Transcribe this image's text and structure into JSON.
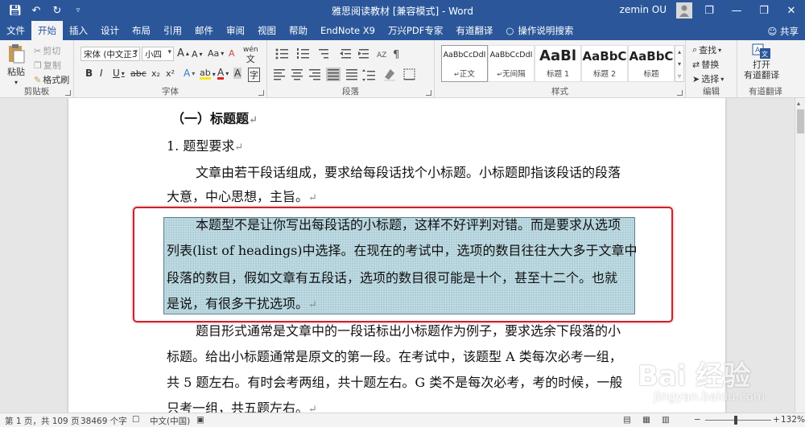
{
  "window": {
    "title": "雅思阅读教材 [兼容模式] - Word",
    "user": "zemin OU"
  },
  "tabs": [
    "文件",
    "开始",
    "插入",
    "设计",
    "布局",
    "引用",
    "邮件",
    "审阅",
    "视图",
    "帮助",
    "EndNote X9",
    "万兴PDF专家",
    "有道翻译"
  ],
  "active_tab": "开始",
  "tell_me": "操作说明搜索",
  "share": "共享",
  "ribbon": {
    "clipboard": {
      "label": "剪贴板",
      "paste": "粘贴",
      "cut": "剪切",
      "copy": "复制",
      "format_painter": "格式刷"
    },
    "font": {
      "label": "字体",
      "font_name": "宋体 (中文正3",
      "font_size": "小四",
      "grow": "A",
      "shrink": "A",
      "aa": "Aa",
      "clear": "A",
      "wen": "wén",
      "bold": "B",
      "italic": "I",
      "underline": "U",
      "strike": "abc",
      "sub": "x₂",
      "sup": "x²",
      "effects": "A",
      "highlight": "ab",
      "color": "A",
      "shading": "A",
      "border": "字"
    },
    "paragraph": {
      "label": "段落"
    },
    "styles": {
      "label": "样式",
      "items": [
        {
          "sample": "AaBbCcDdI",
          "name": "正文"
        },
        {
          "sample": "AaBbCcDdI",
          "name": "无间隔"
        },
        {
          "sample": "AaBl",
          "name": "标题 1"
        },
        {
          "sample": "AaBbC",
          "name": "标题 2"
        },
        {
          "sample": "AaBbC",
          "name": "标题"
        }
      ]
    },
    "editing": {
      "label": "编辑",
      "find": "查找",
      "replace": "替换",
      "select": "选择"
    },
    "translate": {
      "label": "有道翻译",
      "open": "打开",
      "open2": "有道翻译"
    }
  },
  "document": {
    "lines": [
      "（一）标题题",
      "1.  题型要求",
      "文章由若干段话组成，要求给每段话找个小标题。小标题即指该段话的段落",
      "大意，中心思想，主旨。",
      "本题型不是让你写出每段话的小标题，这样不好评判对错。而是要求从选项",
      "列表(list of headings)中选择。在现在的考试中，选项的数目往往大大多于文章中",
      "段落的数目，假如文章有五段话，选项的数目很可能是十个，甚至十二个。也就",
      "是说，有很多干扰选项。",
      "题目形式通常是文章中的一段话标出小标题作为例子，要求选余下段落的小",
      "标题。给出小标题通常是原文的第一段。在考试中，该题型 A 类每次必考一组，",
      "共 5 题左右。有时会考两组，共十题左右。G 类不是每次必考，考的时候，一般",
      "只考一组，共五题左右。"
    ],
    "para_mark": "↵"
  },
  "status": {
    "page": "第 1 页，共 109 页",
    "words": "38469 个字",
    "lang": "中文(中国)",
    "zoom": "132%"
  },
  "watermark": {
    "brand": "Bai 经验",
    "url": "jingyan.baidu.com"
  }
}
